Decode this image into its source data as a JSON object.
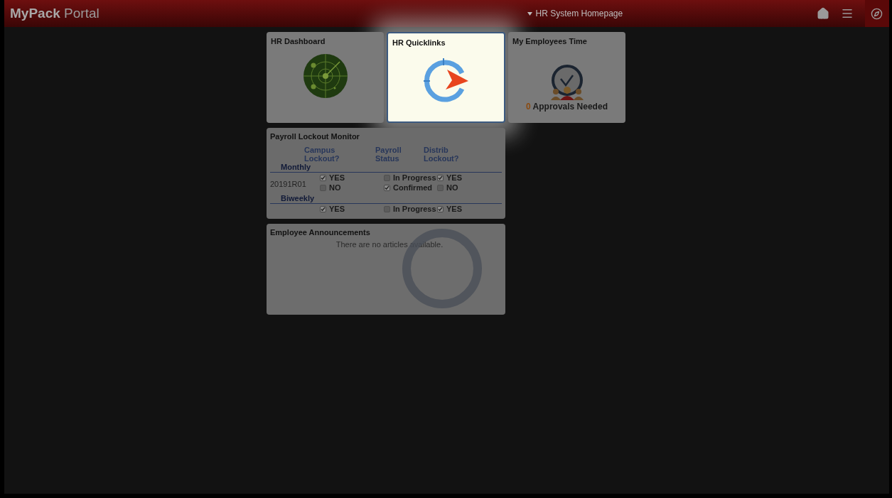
{
  "header": {
    "brand_bold": "MyPack",
    "brand_light": "Portal",
    "page_title": "HR System Homepage"
  },
  "tiles": [
    {
      "kind": "radar",
      "title": "HR Dashboard",
      "selected": false
    },
    {
      "kind": "quicklinks",
      "title": "HR Quicklinks",
      "selected": true
    },
    {
      "kind": "approvals",
      "title": "My Employees Time",
      "count": "0",
      "caption": "Approvals Needed",
      "selected": false
    }
  ],
  "payroll": {
    "title": "Payroll Lockout Monitor",
    "columns": [
      "Campus Lockout?",
      "Payroll Status",
      "Distrib Lockout?"
    ],
    "groups": [
      {
        "name": "Monthly",
        "period": "20191R01",
        "campus": [
          {
            "label": "YES",
            "checked": true
          },
          {
            "label": "NO",
            "checked": false
          }
        ],
        "status": [
          {
            "label": "In Progress",
            "checked": false
          },
          {
            "label": "Confirmed",
            "checked": true
          }
        ],
        "distrib": [
          {
            "label": "YES",
            "checked": true
          },
          {
            "label": "NO",
            "checked": false
          }
        ]
      },
      {
        "name": "Biweekly",
        "campus": [
          {
            "label": "YES",
            "checked": true
          }
        ],
        "status": [
          {
            "label": "In Progress",
            "checked": false
          }
        ],
        "distrib": [
          {
            "label": "YES",
            "checked": true
          }
        ]
      }
    ]
  },
  "announcements": {
    "title": "Employee Announcements",
    "message": "There are no articles available."
  }
}
